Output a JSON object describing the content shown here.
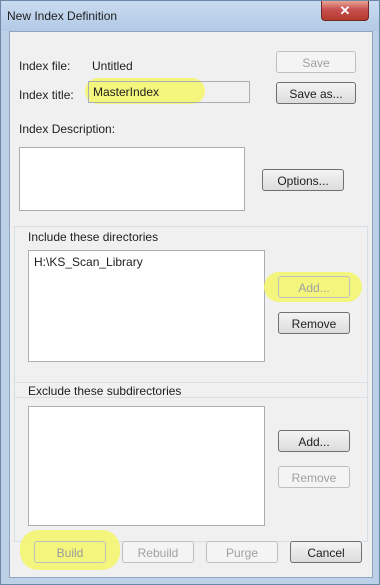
{
  "window": {
    "title": "New Index Definition",
    "close_glyph": "✕"
  },
  "index_file": {
    "label": "Index file:",
    "value": "Untitled"
  },
  "index_title": {
    "label": "Index title:",
    "value": "MasterIndex"
  },
  "index_description": {
    "label": "Index Description:",
    "value": ""
  },
  "buttons": {
    "save": "Save",
    "save_as": "Save as...",
    "options": "Options...",
    "include_add": "Add...",
    "include_remove": "Remove",
    "exclude_add": "Add...",
    "exclude_remove": "Remove",
    "build": "Build",
    "rebuild": "Rebuild",
    "purge": "Purge",
    "cancel": "Cancel"
  },
  "include": {
    "label": "Include these directories",
    "items": [
      "H:\\KS_Scan_Library"
    ]
  },
  "exclude": {
    "label": "Exclude these subdirectories",
    "items": []
  },
  "colors": {
    "highlight": "#f4f570"
  }
}
